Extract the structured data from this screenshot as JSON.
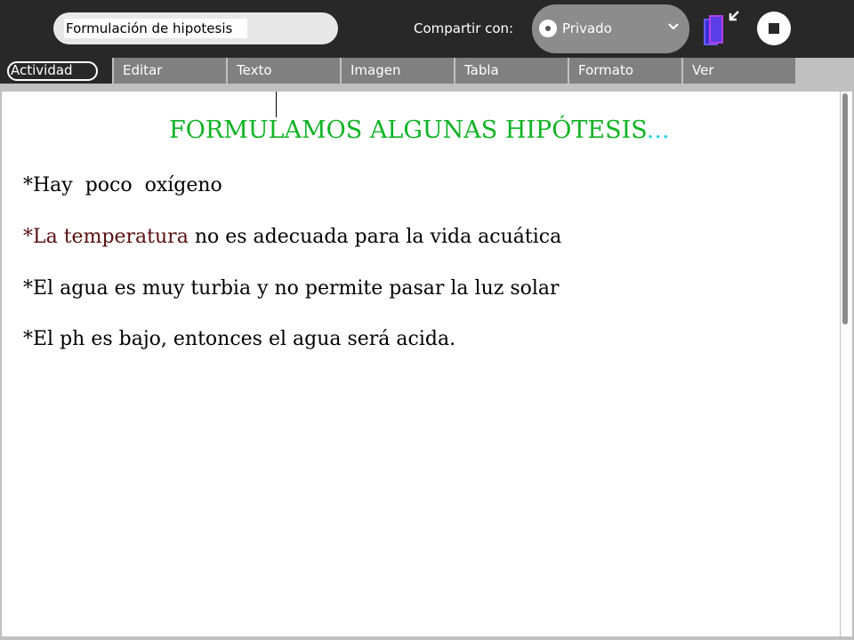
{
  "toolbar": {
    "title_value": "Formulación de hipotesis",
    "share_label": "Compartir con:",
    "share_value": "Privado",
    "share_radio_icon": "radio-dot-icon",
    "share_chevron_icon": "chevron-down-icon",
    "keep_icon": "journal-keep-icon",
    "stop_icon": "stop-icon"
  },
  "tabs": [
    {
      "label": "Actividad",
      "active": true
    },
    {
      "label": "Editar"
    },
    {
      "label": "Texto"
    },
    {
      "label": "Imagen"
    },
    {
      "label": "Tabla"
    },
    {
      "label": "Formato"
    },
    {
      "label": "Ver"
    }
  ],
  "document": {
    "heading": "FORMULAMOS ALGUNAS HIPÓTESIS",
    "heading_dots": "...",
    "lines": [
      {
        "text": "*Hay  poco  oxígeno"
      },
      {
        "highlight": "*La temperatura",
        "rest": " no es adecuada para la vida acuática"
      },
      {
        "text": "*El agua es muy turbia y no permite pasar la luz solar"
      },
      {
        "text": "*El ph es bajo, entonces el agua será acida."
      }
    ],
    "colors": {
      "heading": "#0fb324",
      "dots": "#22d3e0",
      "highlight": "#5a0f0f"
    }
  }
}
